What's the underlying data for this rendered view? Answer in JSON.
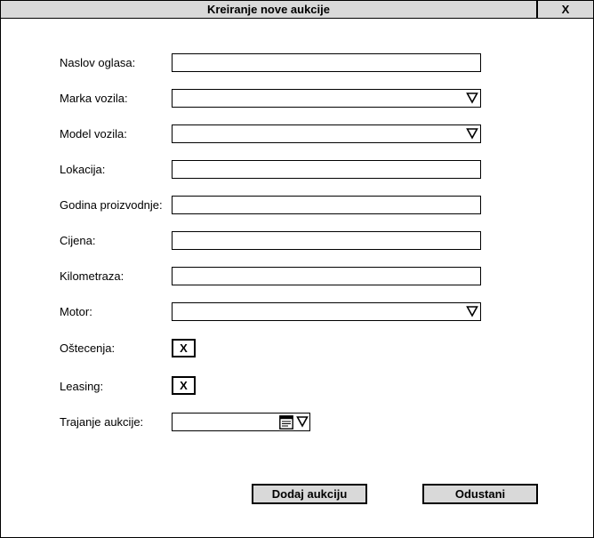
{
  "window": {
    "title": "Kreiranje nove aukcije",
    "close_label": "X"
  },
  "form": {
    "naslov_label": "Naslov oglasa:",
    "naslov_value": "",
    "marka_label": "Marka vozila:",
    "marka_value": "",
    "model_label": "Model vozila:",
    "model_value": "",
    "lokacija_label": "Lokacija:",
    "lokacija_value": "",
    "godina_label": "Godina proizvodnje:",
    "godina_value": "",
    "cijena_label": "Cijena:",
    "cijena_value": "",
    "kilometraza_label": "Kilometraza:",
    "kilometraza_value": "",
    "motor_label": "Motor:",
    "motor_value": "",
    "ostecenja_label": "Oštecenja:",
    "ostecenja_mark": "X",
    "leasing_label": "Leasing:",
    "leasing_mark": "X",
    "trajanje_label": "Trajanje aukcije:",
    "trajanje_value": ""
  },
  "icons": {
    "dropdown": "triangle-down-icon",
    "calendar": "calendar-icon"
  },
  "buttons": {
    "submit_label": "Dodaj aukciju",
    "cancel_label": "Odustani"
  },
  "colors": {
    "titlebar": "#d9d9d9",
    "button": "#d9d9d9",
    "border": "#000000"
  }
}
